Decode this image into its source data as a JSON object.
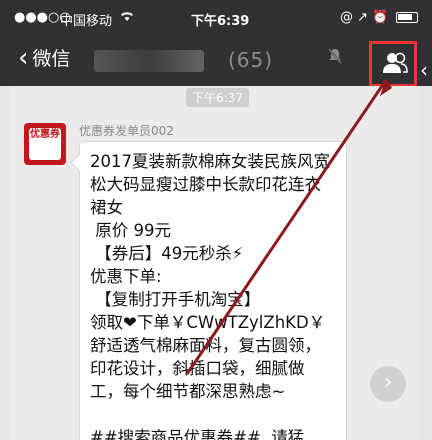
{
  "status_bar": {
    "signal": "●●●○○",
    "carrier": "中国移动",
    "wifi": "WiFi",
    "time": "下午6:39",
    "indicators": "@ ↗ ⏰"
  },
  "nav": {
    "back_label": "微信",
    "title": "(65)",
    "people_icon": "group-members-icon"
  },
  "chat": {
    "timestamp": "下午6:37",
    "sender": "优惠券发单员002",
    "avatar_text": "优惠券",
    "message_lines": [
      "2017夏装新款棉麻女装民族风宽",
      "松大码显瘦过膝中长款印花连衣",
      "裙女",
      " 原价 99元",
      " 【券后】49元秒杀⚡",
      "优惠下单:",
      " 【复制打开手机淘宝】",
      "领取❤下单￥CWwTZylZhKD￥",
      "舒适透气棉麻面料，复古圆领，",
      "印花设计，斜插口袋，细腻做",
      "工，每个细节都深思熟虑~",
      "",
      "##搜索商品优惠券##  请猛"
    ]
  },
  "colors": {
    "nav_bg": "#2f3136",
    "chat_bg": "#ebebeb",
    "highlight": "#e33333",
    "arrow": "#8b1a1a"
  }
}
